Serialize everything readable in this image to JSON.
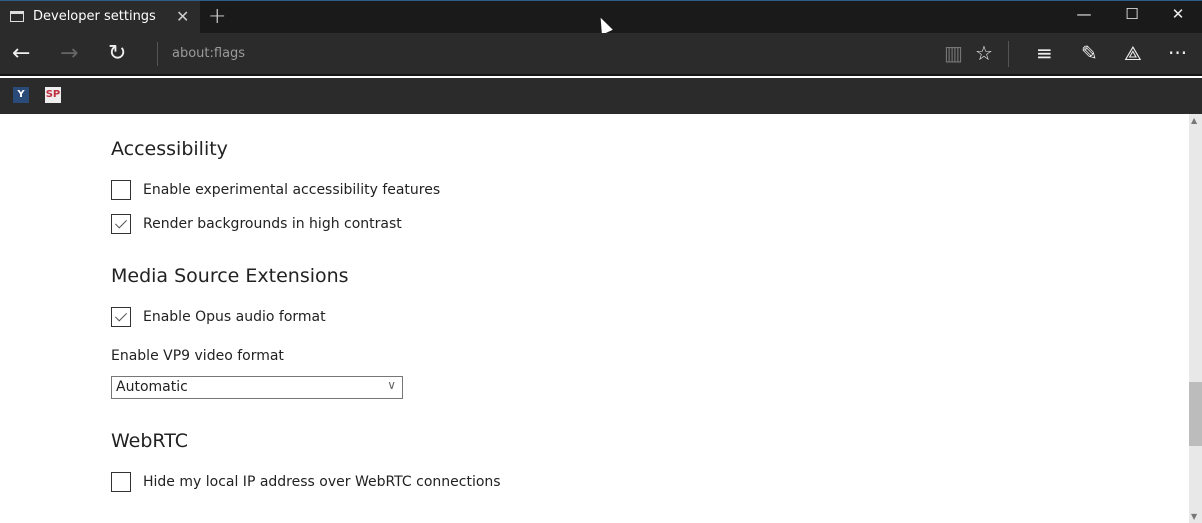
{
  "window": {
    "tab_title": "Developer settings",
    "tab_close": "✕",
    "new_tab": "+",
    "minimize": "—",
    "maximize": "☐",
    "close": "✕"
  },
  "toolbar": {
    "back": "←",
    "forward": "→",
    "refresh": "↻",
    "address": "about:flags",
    "reading_view": "▥",
    "favorite": "☆",
    "hub": "≡",
    "web_note": "✎",
    "share": "⟁",
    "more": "···"
  },
  "bookmarks": [
    {
      "label": "Y"
    },
    {
      "label": "SP"
    }
  ],
  "sections": [
    {
      "title": "Accessibility",
      "items": [
        {
          "label": "Enable experimental accessibility features",
          "checked": false
        },
        {
          "label": "Render backgrounds in high contrast",
          "checked": true
        }
      ]
    },
    {
      "title": "Media Source Extensions",
      "items": [
        {
          "label": "Enable Opus audio format",
          "checked": true
        }
      ],
      "select": {
        "label": "Enable VP9 video format",
        "value": "Automatic"
      }
    },
    {
      "title": "WebRTC",
      "items": [
        {
          "label": "Hide my local IP address over WebRTC connections",
          "checked": false
        }
      ]
    }
  ]
}
